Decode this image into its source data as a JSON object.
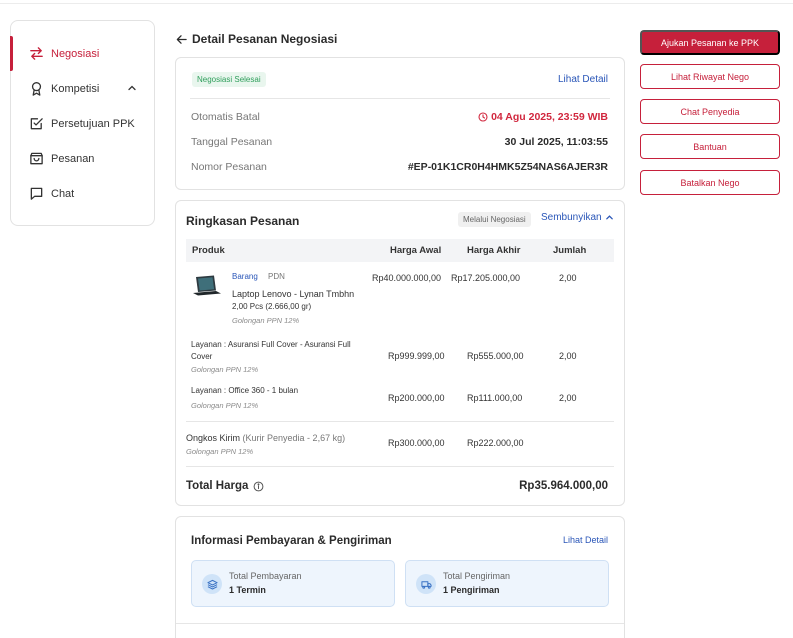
{
  "sidebar": {
    "items": [
      {
        "label": "Negosiasi",
        "icon": "swap-arrows-icon"
      },
      {
        "label": "Kompetisi",
        "icon": "award-icon"
      },
      {
        "label": "Persetujuan PPK",
        "icon": "checkbox-icon"
      },
      {
        "label": "Pesanan",
        "icon": "shopping-bag-icon"
      },
      {
        "label": "Chat",
        "icon": "chat-bubble-icon"
      }
    ],
    "active_color": "#c6203b"
  },
  "header": {
    "title": "Detail Pesanan Negosiasi"
  },
  "order_info": {
    "status_badge": "Negosiasi Selesai",
    "detail_link": "Lihat Detail",
    "rows": [
      {
        "label": "Otomatis Batal",
        "value": "04 Agu 2025, 23:59 WIB"
      },
      {
        "label": "Tanggal Pesanan",
        "value": "30 Jul 2025, 11:03:55"
      },
      {
        "label": "Nomor Pesanan",
        "value": "#EP-01K1CR0H4HMK5Z54NAS6AJER3R"
      }
    ]
  },
  "summary": {
    "title": "Ringkasan Pesanan",
    "via_badge": "Melalui Negosiasi",
    "toggle_label": "Sembunyikan",
    "columns": [
      "Produk",
      "Harga Awal",
      "Harga Akhir",
      "Jumlah"
    ],
    "product": {
      "tag_type": "Barang",
      "tag_origin": "PDN",
      "name": "Laptop Lenovo - Lynan Tmbhn",
      "qty_weight": "2,00 Pcs (2.666,00 gr)",
      "tax": "Golongan PPN 12%",
      "price_initial": "Rp40.000.000,00",
      "price_final": "Rp17.205.000,00",
      "quantity": "2,00"
    },
    "services": [
      {
        "prefix": "Layanan : ",
        "name": "Asuransi Full Cover - Asuransi Full Cover",
        "tax": "Golongan PPN 12%",
        "price_initial": "Rp999.999,00",
        "price_final": "Rp555.000,00",
        "quantity": "2,00"
      },
      {
        "prefix": "Layanan : ",
        "name": "Office 360 - 1 bulan",
        "tax": "Golongan PPN 12%",
        "price_initial": "Rp200.000,00",
        "price_final": "Rp111.000,00",
        "quantity": "2,00"
      }
    ],
    "shipping": {
      "label": "Ongkos Kirim",
      "detail": "(Kurir Penyedia - 2,67 kg)",
      "tax": "Golongan PPN 12%",
      "price_initial": "Rp300.000,00",
      "price_final": "Rp222.000,00"
    },
    "total_label": "Total Harga",
    "total_value": "Rp35.964.000,00"
  },
  "payment": {
    "title": "Informasi Pembayaran & Pengiriman",
    "detail_link": "Lihat Detail",
    "boxes": [
      {
        "label": "Total Pembayaran",
        "value": "1 Termin",
        "icon": "layers-icon"
      },
      {
        "label": "Total Pengiriman",
        "value": "1 Pengiriman",
        "icon": "truck-icon"
      }
    ]
  },
  "actions": {
    "primary": "Ajukan Pesanan ke PPK",
    "secondary": [
      "Lihat Riwayat Nego",
      "Chat Penyedia",
      "Bantuan",
      "Batalkan Nego"
    ]
  },
  "colors": {
    "brand": "#c6203b",
    "link": "#2a56b8",
    "success": "#2f9e5b"
  }
}
